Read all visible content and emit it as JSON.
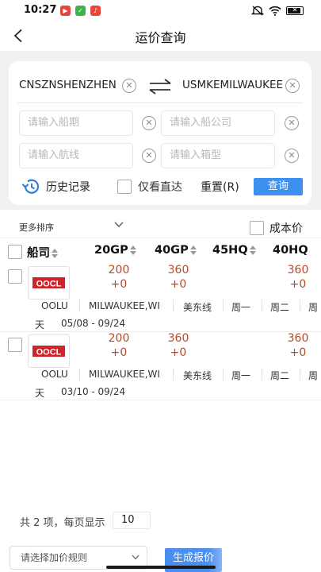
{
  "status_bar": {
    "time": "10:27"
  },
  "nav": {
    "title": "运价查询"
  },
  "search": {
    "origin": "CNSZNSHENZHEN",
    "destination": "USMKEMILWAUKEE",
    "placeholders": {
      "sailing": "请输入船期",
      "carrier": "请输入船公司",
      "route": "请输入航线",
      "container": "请输入箱型"
    },
    "history_label": "历史记录",
    "direct_only_label": "仅看直达",
    "reset_label": "重置(R)",
    "query_label": "查询"
  },
  "sort": {
    "more_sort_label": "更多排序",
    "cost_price_label": "成本价"
  },
  "table": {
    "columns": {
      "carrier": "船司",
      "gp20": "20GP",
      "gp40": "40GP",
      "hq45": "45HQ",
      "hq40": "40HQ"
    },
    "rows": [
      {
        "logo": "OOCL",
        "price_20gp": "200",
        "delta_20gp": "+0",
        "price_40gp": "360",
        "delta_40gp": "+0",
        "price_40hq": "360",
        "delta_40hq": "+0",
        "carrier_code": "OOLU",
        "destination": "MILWAUKEE,WI",
        "route": "美东线",
        "day1": "周一",
        "day2": "周二",
        "day3_cut": "周",
        "transit_cont": "天",
        "validity": "05/08 - 09/24"
      },
      {
        "logo": "OOCL",
        "price_20gp": "200",
        "delta_20gp": "+0",
        "price_40gp": "360",
        "delta_40gp": "+0",
        "price_40hq": "360",
        "delta_40hq": "+0",
        "carrier_code": "OOLU",
        "destination": "MILWAUKEE,WI",
        "route": "美东线",
        "day1": "周一",
        "day2": "周二",
        "day3_cut": "周",
        "transit_cont": "天",
        "validity": "03/10 - 09/24"
      }
    ]
  },
  "footer": {
    "total_text": "共 2 项，每页显示",
    "page_size": "10",
    "rule_placeholder": "请选择加价规则",
    "generate_label": "生成报价"
  },
  "colors": {
    "accent": "#3d8ff0",
    "price": "#b44a2a",
    "oocl_red": "#d2232a",
    "background": "#f1f1f3"
  }
}
